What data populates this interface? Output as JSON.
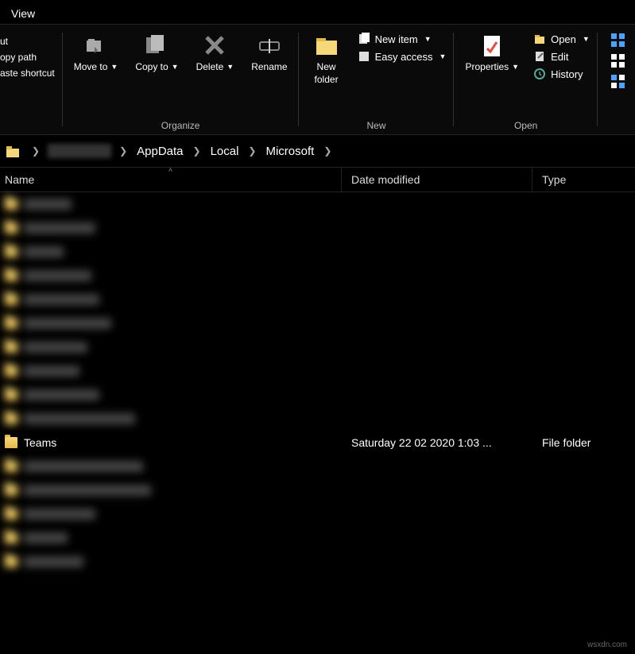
{
  "tab": {
    "view": "View"
  },
  "ribbon": {
    "clipboard": {
      "cut": "ut",
      "copy_path": "opy path",
      "paste_shortcut": "aste shortcut"
    },
    "organize": {
      "move_to": "Move to",
      "copy_to": "Copy to",
      "delete": "Delete",
      "rename": "Rename",
      "label": "Organize"
    },
    "new": {
      "new_folder": "New folder",
      "new_item": "New item",
      "easy_access": "Easy access",
      "label": "New"
    },
    "open": {
      "properties": "Properties",
      "open": "Open",
      "edit": "Edit",
      "history": "History",
      "label": "Open"
    }
  },
  "breadcrumb": {
    "items": [
      "",
      "AppData",
      "Local",
      "Microsoft"
    ]
  },
  "columns": {
    "name": "Name",
    "date": "Date modified",
    "type": "Type"
  },
  "rows": {
    "teams": {
      "name": "Teams",
      "date": "Saturday 22 02 2020 1:03 ...",
      "type": "File folder"
    },
    "blurred_before": 10,
    "blurred_after": 5,
    "blur_name_widths": [
      60,
      90,
      50,
      85,
      95,
      110,
      80,
      70,
      95,
      140
    ],
    "blur_name_widths_after": [
      150,
      160,
      90,
      55,
      75
    ]
  },
  "watermark": "wsxdn.com"
}
